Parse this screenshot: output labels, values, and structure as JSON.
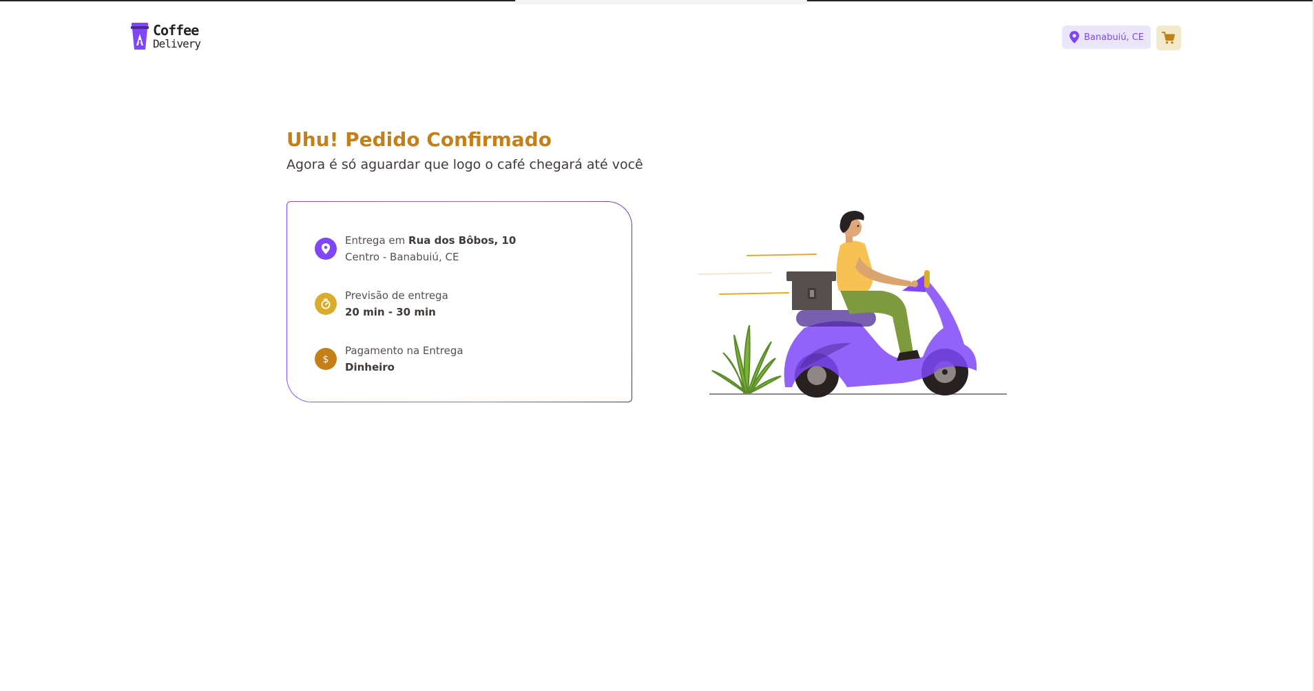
{
  "header": {
    "logo": {
      "line1": "Coffee",
      "line2": "Delivery"
    },
    "location": "Banabuiú, CE",
    "location_icon": "map-pin-icon",
    "cart_icon": "shopping-cart-icon"
  },
  "main": {
    "title": "Uhu! Pedido Confirmado",
    "subtitle": "Agora é só aguardar que logo o café chegará até você"
  },
  "order": {
    "address": {
      "icon": "map-pin-icon",
      "prefix": "Entrega em ",
      "street": "Rua dos Bôbos, 10",
      "district": "Centro - Banabuiú, CE"
    },
    "delivery": {
      "icon": "timer-icon",
      "label": "Previsão de entrega",
      "value": "20 min - 30 min"
    },
    "payment": {
      "icon": "currency-dollar-icon",
      "label": "Pagamento na Entrega",
      "value": "Dinheiro"
    }
  },
  "colors": {
    "purple": "#8047f8",
    "purple_dark": "#4b2995",
    "yellow": "#dbac2c",
    "yellow_dark": "#c47f17",
    "purple_light": "#ebe5f9",
    "yellow_light": "#f1e9c9"
  }
}
